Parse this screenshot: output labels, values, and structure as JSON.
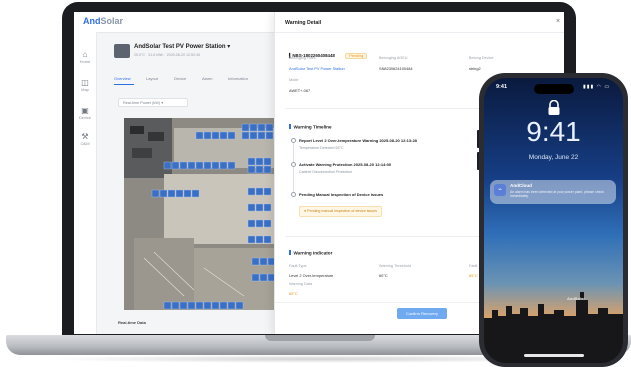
{
  "app": {
    "brand_main": "And",
    "brand_accent": "Solar"
  },
  "left_nav": [
    {
      "label": "Home",
      "icon": "home-icon"
    },
    {
      "label": "Map",
      "icon": "map-icon"
    },
    {
      "label": "Device",
      "icon": "device-icon"
    },
    {
      "label": "O&M",
      "icon": "tools-icon"
    }
  ],
  "station": {
    "name": "AndSolar Test PV Power Station",
    "meta": "25.0°C  ·  31.6 kWh  ·  2025-08-20 12:52:45"
  },
  "tabs": [
    {
      "label": "Overview",
      "active": true
    },
    {
      "label": "Layout",
      "active": false
    },
    {
      "label": "Device",
      "active": false
    },
    {
      "label": "Alarm",
      "active": false
    },
    {
      "label": "Information",
      "active": false
    }
  ],
  "view_select": "Real-time Power (kW)",
  "bottom_label": "Real-time Data",
  "drawer": {
    "title": "Warning Detail",
    "code": "NBS-1802260408448",
    "status": "Pending",
    "fields": [
      {
        "label": "Belonging Plant",
        "value": "AndSolar Test PV Power Station",
        "style": "link"
      },
      {
        "label": "Belonging AGEU",
        "value": "SN8230624100484",
        "style": "normal"
      },
      {
        "label": "Belong Device",
        "value": "string2",
        "style": "normal"
      },
      {
        "label": "Mode",
        "value": "AWET+-067",
        "style": "normal"
      }
    ],
    "timeline_title": "Warning Timeline",
    "timeline": [
      {
        "title": "Report Level 2 Over-temperature Warning  2025-08-20 12:13:28",
        "sub": "Temperature Detected 65°C"
      },
      {
        "title": "Activate Warning Protection  2025-08-20 12:14:00",
        "sub": "Cabinet Disconnection Protection"
      },
      {
        "title": "Pending Manual Inspection of Device Issues",
        "sub": ""
      }
    ],
    "timeline_pill": "Pending manual inspection of device issues",
    "indicator_title": "Warning Indicator",
    "indicators": [
      {
        "label": "Fault Type",
        "value": "Level 2 Over-temperature",
        "style": "normal"
      },
      {
        "label": "Warning Threshold",
        "value": "60°C",
        "style": "normal"
      },
      {
        "label": "Fault",
        "value": "65°C",
        "style": "warn"
      },
      {
        "label": "Warning Data",
        "value": "65°C",
        "style": "warn"
      }
    ],
    "confirm_label": "Confirm Recovery"
  },
  "phone": {
    "status_time": "9:41",
    "status_icons": "▮▮▮ ◠ ▭",
    "lock_time": "9:41",
    "date": "Monday, June 22",
    "notif_title": "AndCloud",
    "notif_body": "An alarm has been detected at your power plant, please check immediately.",
    "brand": "AndSolar"
  },
  "colors": {
    "accent": "#2f6fe4",
    "warning": "#e59a1c",
    "button": "#6fa9f0"
  }
}
